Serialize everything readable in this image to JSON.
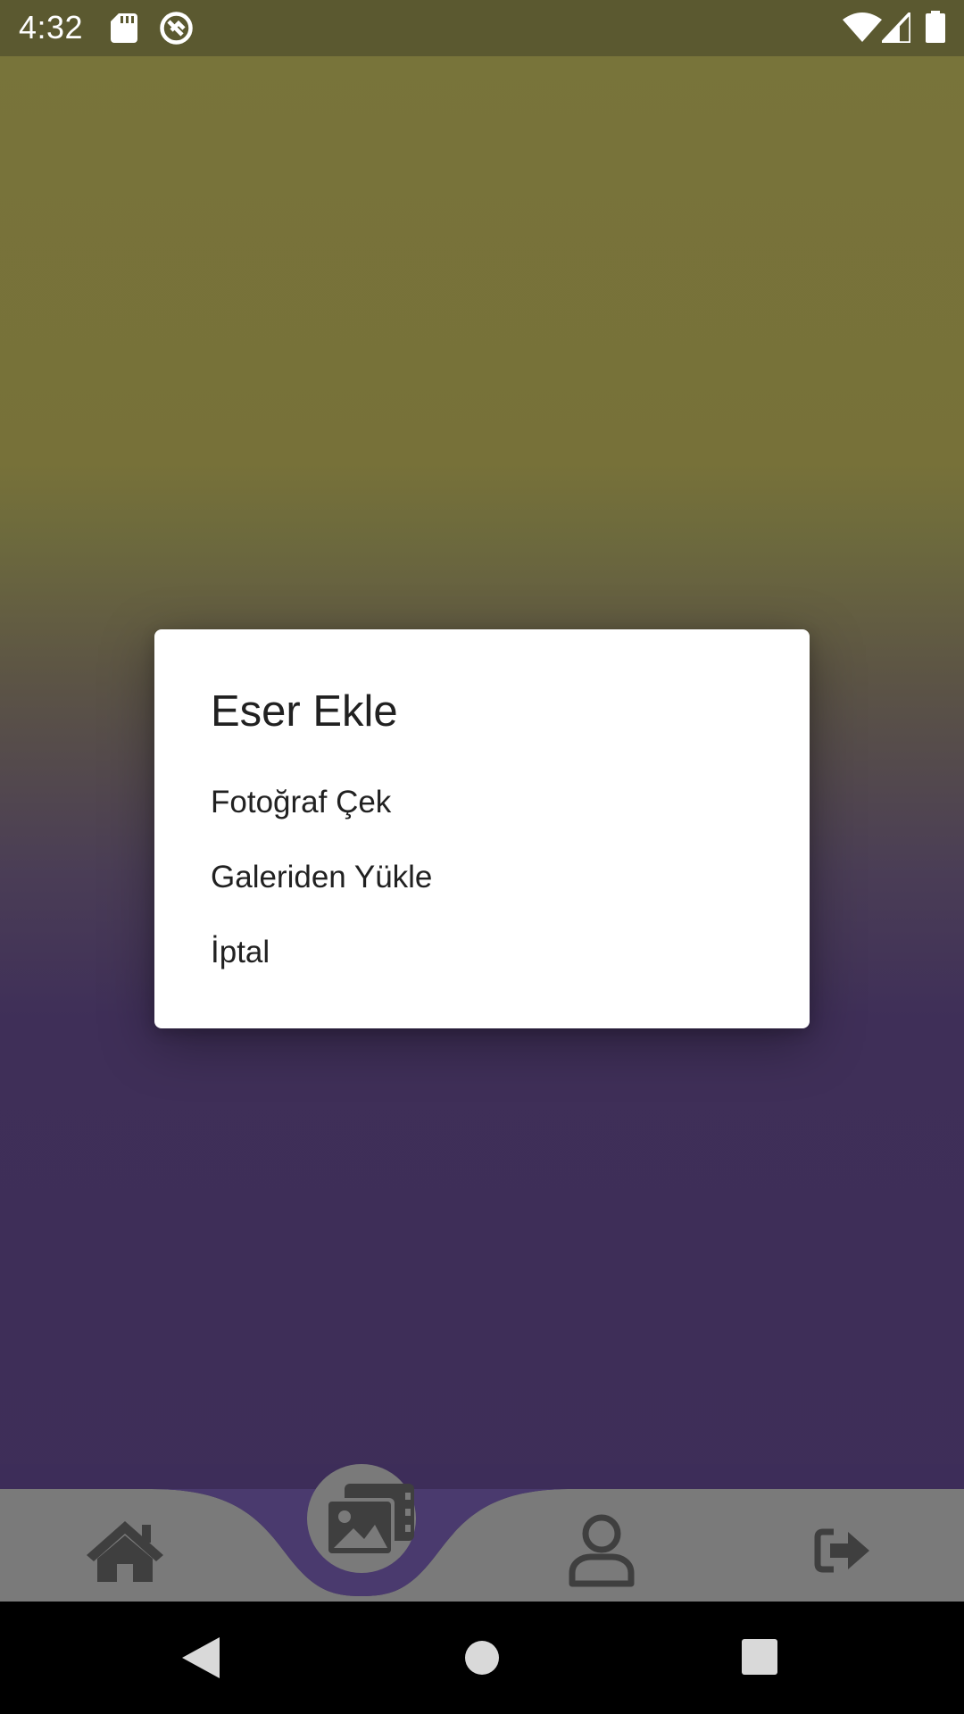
{
  "status_bar": {
    "time": "4:32",
    "left_icons": [
      "sd-card-icon",
      "sync-icon"
    ],
    "right_icons": [
      "wifi-icon",
      "cell-signal-icon",
      "battery-icon"
    ]
  },
  "dialog": {
    "title": "Eser Ekle",
    "options": [
      "Fotoğraf Çek",
      "Galeriden Yükle",
      "İptal"
    ]
  },
  "bottom_nav": {
    "items": [
      "home-icon",
      "gallery-icon",
      "profile-icon",
      "logout-icon"
    ],
    "active": "gallery-icon",
    "bar_color": "#7a7a7a",
    "icon_color": "#3f3f3f",
    "notch_color": "#4a3a6e"
  },
  "system_nav": {
    "buttons": [
      "back-icon",
      "home-circle-icon",
      "recents-icon"
    ]
  }
}
